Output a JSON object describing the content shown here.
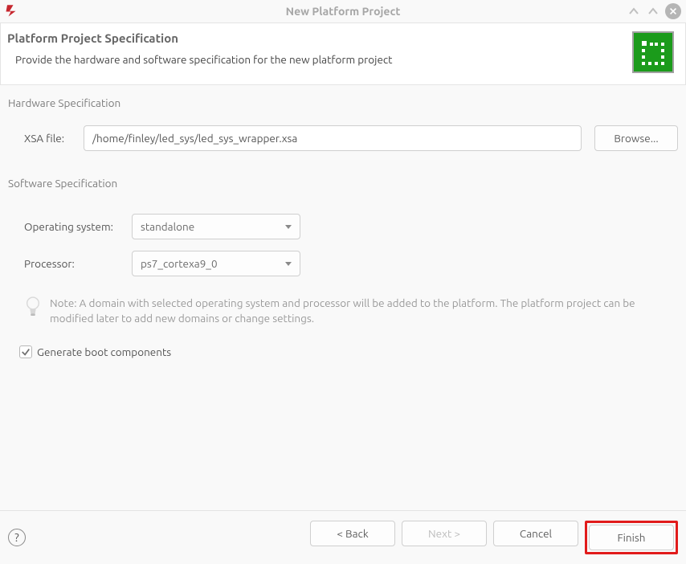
{
  "titlebar": {
    "title": "New Platform Project"
  },
  "header": {
    "heading": "Platform Project Specification",
    "subtitle": "Provide the hardware and software specification for the new platform project"
  },
  "hardware": {
    "section_label": "Hardware Specification",
    "xsa_label": "XSA file:",
    "xsa_value": "/home/finley/led_sys/led_sys_wrapper.xsa",
    "browse_label": "Browse..."
  },
  "software": {
    "section_label": "Software Specification",
    "os_label": "Operating system:",
    "os_value": "standalone",
    "processor_label": "Processor:",
    "processor_value": "ps7_cortexa9_0",
    "note": "Note: A domain with selected operating system and processor will be added to the platform. The platform project can be modified later to add new domains or change settings.",
    "generate_boot_label": "Generate boot components",
    "generate_boot_checked": true
  },
  "footer": {
    "back_label": "< Back",
    "next_label": "Next >",
    "cancel_label": "Cancel",
    "finish_label": "Finish"
  }
}
